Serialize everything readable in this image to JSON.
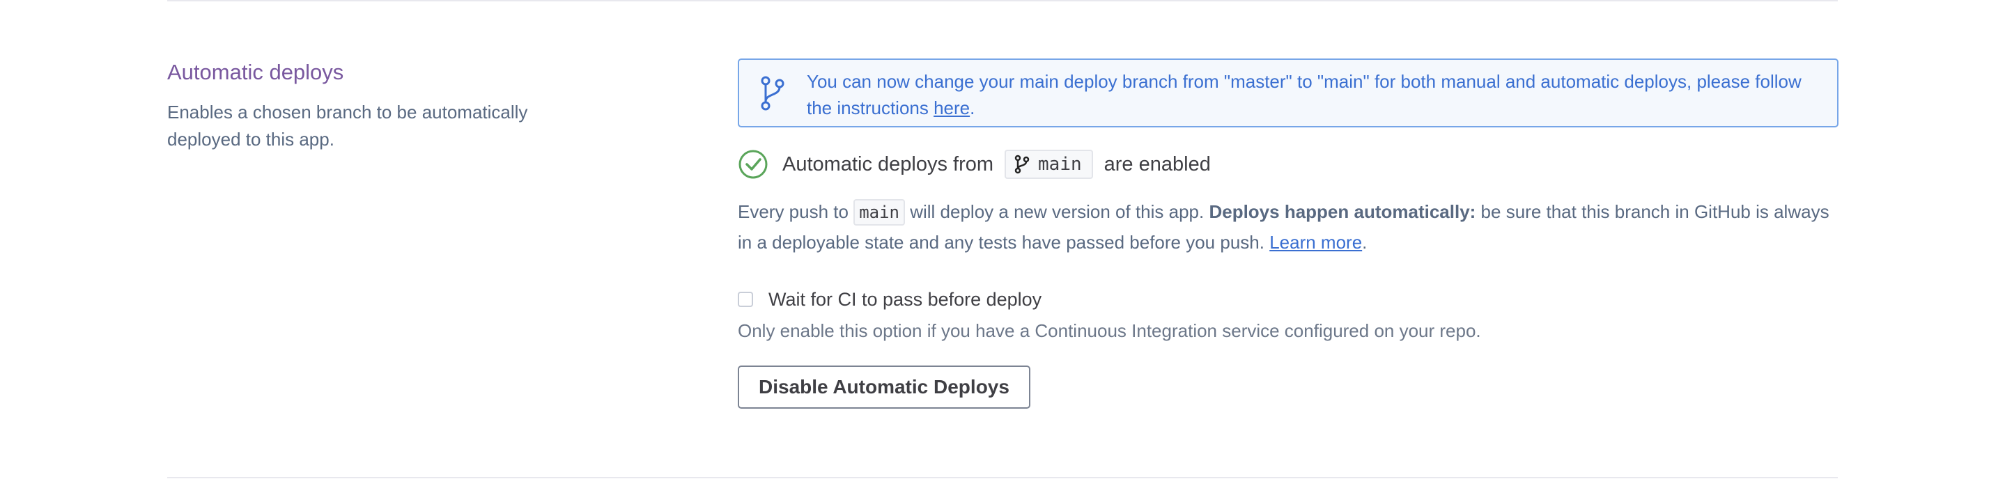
{
  "section": {
    "title": "Automatic deploys",
    "description": "Enables a chosen branch to be automatically deployed to this app."
  },
  "notice": {
    "icon": "git-branch-icon",
    "text": "You can now change your main deploy branch from \"master\" to \"main\" for both manual and automatic deploys, please follow the instructions ",
    "link_label": "here",
    "suffix": ".",
    "colors": {
      "text": "#3a6fd1",
      "border": "#77a6e8",
      "background": "#f4f8fd"
    }
  },
  "status": {
    "icon": "check-circle-icon",
    "prefix": "Automatic deploys from",
    "branch_icon": "git-branch-icon",
    "branch": "main",
    "suffix": "are enabled",
    "color_check": "#5aa55a"
  },
  "explanation": {
    "part1": "Every push to ",
    "branch": "main",
    "part2": " will deploy a new version of this app. ",
    "bold": "Deploys happen automatically:",
    "part3": " be sure that this branch in GitHub is always in a deployable state and any tests have passed before you push. ",
    "link_label": "Learn more",
    "suffix": "."
  },
  "ci_option": {
    "label": "Wait for CI to pass before deploy",
    "checked": false,
    "hint": "Only enable this option if you have a Continuous Integration service configured on your repo."
  },
  "disable_button": {
    "label": "Disable Automatic Deploys"
  },
  "colors": {
    "title": "#79589f",
    "link": "#3a6fd1"
  }
}
